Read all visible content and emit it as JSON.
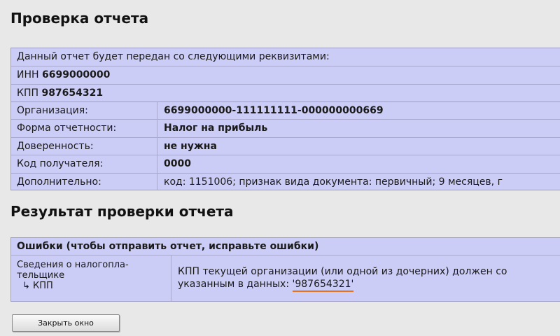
{
  "report_check": {
    "title": "Проверка отчета",
    "intro": "Данный отчет будет передан со следующими реквизитами:",
    "inn_label": "ИНН",
    "inn_value": "6699000000",
    "kpp_label": "КПП",
    "kpp_value": "987654321",
    "details": [
      {
        "label": "Организация:",
        "value": "6699000000-111111111-000000000669",
        "bold": true
      },
      {
        "label": "Форма отчетности:",
        "value": "Налог на прибыль",
        "bold": true
      },
      {
        "label": "Доверенность:",
        "value": "не нужна",
        "bold": true
      },
      {
        "label": "Код получателя:",
        "value": "0000",
        "bold": true
      },
      {
        "label": "Дополнительно:",
        "value": "код: 1151006; признак вида документа: первичный; 9 месяцев, г",
        "bold": false
      }
    ]
  },
  "check_result": {
    "title": "Результат проверки отчета",
    "errors_header": "Ошибки (чтобы отправить отчет, исправьте ошибки)",
    "error": {
      "field_line1": "Сведения о налогопла-",
      "field_line2": "тельщике",
      "field_sub_arrow": "↳",
      "field_sub": "КПП",
      "message_line1": "КПП текущей организации (или одной из дочерних) должен со",
      "message_line2_prefix": "указанным в данных: ",
      "message_value": "'987654321'"
    }
  },
  "buttons": {
    "close_label": "Закрыть окно"
  },
  "colors": {
    "background": "#e8e8e8",
    "panel": "#cccdf7",
    "highlight_underline": "#e8731f"
  }
}
